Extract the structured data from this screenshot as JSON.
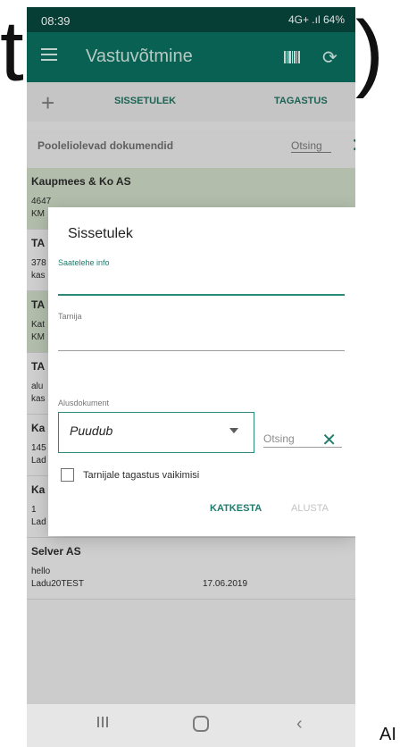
{
  "status": {
    "time": "08:39",
    "right": "4G+ .ıl 64%"
  },
  "app": {
    "title": "Vastuvõtmine"
  },
  "tabs": {
    "plus": "+",
    "tab1": "SISSETULEK",
    "tab2": "TAGASTUS"
  },
  "filter": {
    "pending_label": "Pooleliolevad dokumendid",
    "search_placeholder": "Otsing",
    "close": "✕"
  },
  "list": [
    {
      "name": "Kaupmees & Ko AS",
      "line2": "4647",
      "line3": "KM",
      "date": ""
    },
    {
      "name": "TA",
      "line2": "378",
      "line3": "kas",
      "date": ""
    },
    {
      "name": "TA",
      "line2": "Kat",
      "line3": "KM",
      "date": ""
    },
    {
      "name": "TA",
      "line2": "alu",
      "line3": "kas",
      "date": ""
    },
    {
      "name": "Ka",
      "line2": "145",
      "line3": "Lad",
      "date": ""
    },
    {
      "name": "Ka",
      "line2": "1",
      "line3": "Lad",
      "date": ""
    },
    {
      "name": "Selver AS",
      "line2": "hello",
      "line3": "Ladu20TEST",
      "date": "17.06.2019"
    }
  ],
  "dialog": {
    "title": "Sissetulek",
    "info_label": "Saatelehe info",
    "supplier_label": "Tarnija",
    "basis_label": "Alusdokument",
    "basis_value": "Puudub",
    "search_placeholder": "Otsing",
    "checkbox_label": "Tarnijale tagastus vaikimisi",
    "cancel": "KATKESTA",
    "start": "ALUSTA"
  },
  "background_text": {
    "left": "t",
    "right": ")",
    "bottom": "AI"
  }
}
